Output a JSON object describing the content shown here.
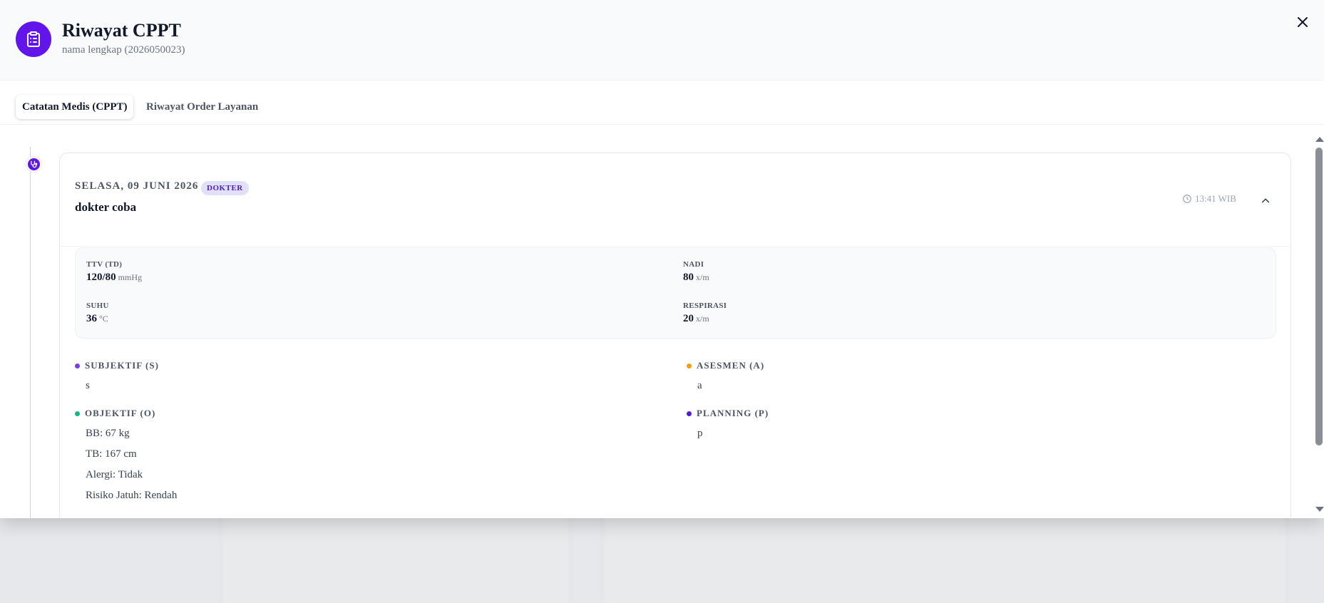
{
  "header": {
    "title": "Riwayat CPPT",
    "subtitle": "nama lengkap (2026050023)",
    "icon": "clipboard-icon",
    "accent": "#6215ea"
  },
  "tabs": [
    {
      "label": "Catatan Medis (CPPT)",
      "active": true
    },
    {
      "label": "Riwayat Order Layanan",
      "active": false
    }
  ],
  "record": {
    "date": "SELASA, 09 JUNI 2026",
    "role_badge": "DOKTER",
    "doctor": "dokter coba",
    "time": "13:41 WIB",
    "vitals": [
      {
        "label": "TTV (TD)",
        "value": "120/80",
        "unit": "mmHg"
      },
      {
        "label": "NADI",
        "value": "80",
        "unit": "x/m"
      },
      {
        "label": "SUHU",
        "value": "36",
        "unit": "°C"
      },
      {
        "label": "RESPIRASI",
        "value": "20",
        "unit": "x/m"
      }
    ],
    "soap": {
      "subjektif": {
        "label": "SUBJEKTIF (S)",
        "lines": [
          "s"
        ],
        "color": "#7c3aed"
      },
      "objektif": {
        "label": "OBJEKTIF (O)",
        "lines": [
          "BB: 67 kg",
          "TB: 167 cm",
          "Alergi: Tidak",
          "Risiko Jatuh: Rendah"
        ],
        "color": "#10b981"
      },
      "asesmen": {
        "label": "ASESMEN (A)",
        "lines": [
          "a"
        ],
        "color": "#f59e0b"
      },
      "planning": {
        "label": "PLANNING (P)",
        "lines": [
          "p"
        ],
        "color": "#4f1dd8"
      }
    }
  }
}
